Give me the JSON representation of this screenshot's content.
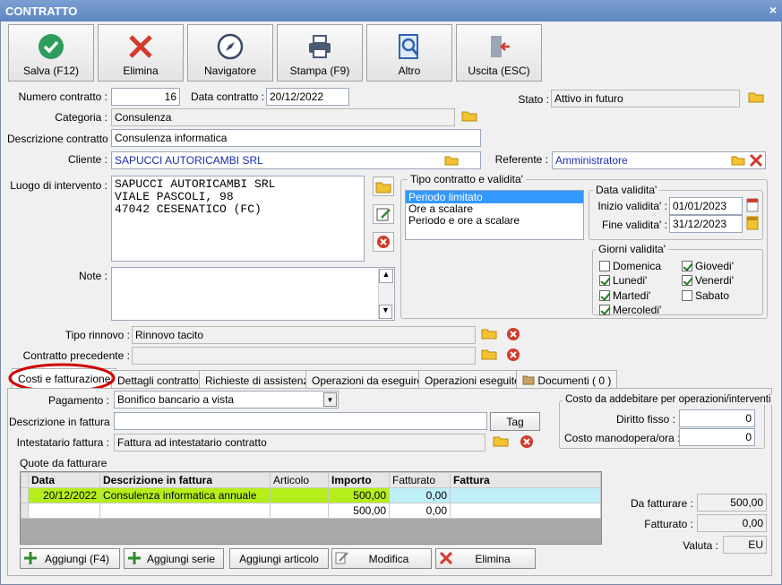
{
  "window": {
    "title": "CONTRATTO",
    "close": "×"
  },
  "toolbar": [
    {
      "label": "Salva (F12)"
    },
    {
      "label": "Elimina"
    },
    {
      "label": "Navigatore"
    },
    {
      "label": "Stampa (F9)"
    },
    {
      "label": "Altro"
    },
    {
      "label": "Uscita (ESC)"
    }
  ],
  "form": {
    "numero_label": "Numero contratto :",
    "numero_value": "16",
    "data_label": "Data contratto :",
    "data_value": "20/12/2022",
    "stato_label": "Stato :",
    "stato_value": "Attivo in futuro",
    "categoria_label": "Categoria :",
    "categoria_value": "Consulenza",
    "descrizione_label": "Descrizione contratto :",
    "descrizione_value": "Consulenza informatica",
    "cliente_label": "Cliente :",
    "cliente_value": "SAPUCCI AUTORICAMBI SRL",
    "referente_label": "Referente :",
    "referente_value": "Amministratore",
    "luogo_label": "Luogo di intervento :",
    "luogo_lines": [
      "SAPUCCI AUTORICAMBI SRL",
      "VIALE PASCOLI, 98",
      "47042 CESENATICO (FC)"
    ],
    "note_label": "Note :",
    "tipo_rinnovo_label": "Tipo rinnovo :",
    "tipo_rinnovo_value": "Rinnovo tacito",
    "contratto_prec_label": "Contratto precedente :",
    "contratto_prec_value": ""
  },
  "tipo_contratto": {
    "title": "Tipo contratto e validita'",
    "options": [
      "Periodo limitato",
      "Ore a scalare",
      "Periodo e ore a scalare"
    ],
    "selected": "Periodo limitato"
  },
  "data_validita": {
    "title": "Data validita'",
    "inizio_label": "Inizio validita' :",
    "inizio_value": "01/01/2023",
    "fine_label": "Fine validita' :",
    "fine_value": "31/12/2023"
  },
  "giorni": {
    "title": "Giorni validita'",
    "items": [
      {
        "label": "Domenica",
        "checked": false
      },
      {
        "label": "Giovedi'",
        "checked": true
      },
      {
        "label": "Lunedi'",
        "checked": true
      },
      {
        "label": "Venerdi'",
        "checked": true
      },
      {
        "label": "Martedi'",
        "checked": true
      },
      {
        "label": "Sabato",
        "checked": false
      },
      {
        "label": "Mercoledi'",
        "checked": true
      }
    ]
  },
  "tabs": [
    {
      "label": "Costi e fatturazione"
    },
    {
      "label": "Dettagli contratto"
    },
    {
      "label": "Richieste di assistenza"
    },
    {
      "label": "Operazioni da eseguire"
    },
    {
      "label": "Operazioni eseguite"
    },
    {
      "label": "Documenti ( 0 )"
    }
  ],
  "billing": {
    "pagamento_label": "Pagamento :",
    "pagamento_value": "Bonifico bancario a vista",
    "desc_fattura_label": "Descrizione in fattura",
    "desc_fattura_value": "",
    "tag_label": "Tag",
    "intestatario_label": "Intestatario fattura :",
    "intestatario_value": "Fattura ad intestatario contratto",
    "quote_label": "Quote da fatturare"
  },
  "costo": {
    "title": "Costo da addebitare per operazioni/interventi",
    "diritto_label": "Diritto fisso :",
    "diritto_value": "0",
    "manodopera_label": "Costo manodopera/ora :",
    "manodopera_value": "0"
  },
  "table": {
    "headers": [
      "Data",
      "Descrizione in fattura",
      "Articolo",
      "Importo",
      "Fatturato",
      "Fattura"
    ],
    "rows": [
      [
        "20/12/2022",
        "Consulenza informatica annuale",
        "",
        "500,00",
        "0,00",
        ""
      ],
      [
        "",
        "",
        "",
        "500,00",
        "0,00",
        ""
      ]
    ]
  },
  "totals": {
    "da_fatturare_label": "Da fatturare :",
    "da_fatturare_value": "500,00",
    "fatturato_label": "Fatturato :",
    "fatturato_value": "0,00",
    "valuta_label": "Valuta :",
    "valuta_value": "EU"
  },
  "bottom_buttons": [
    {
      "label": "Aggiungi (F4)"
    },
    {
      "label": "Aggiungi serie"
    },
    {
      "label": "Aggiungi articolo"
    },
    {
      "label": "Modifica"
    },
    {
      "label": "Elimina"
    }
  ],
  "colors": {
    "highlight_row": "#b5ee1a",
    "selection": "#3399ff",
    "annotation": "#d00000"
  }
}
